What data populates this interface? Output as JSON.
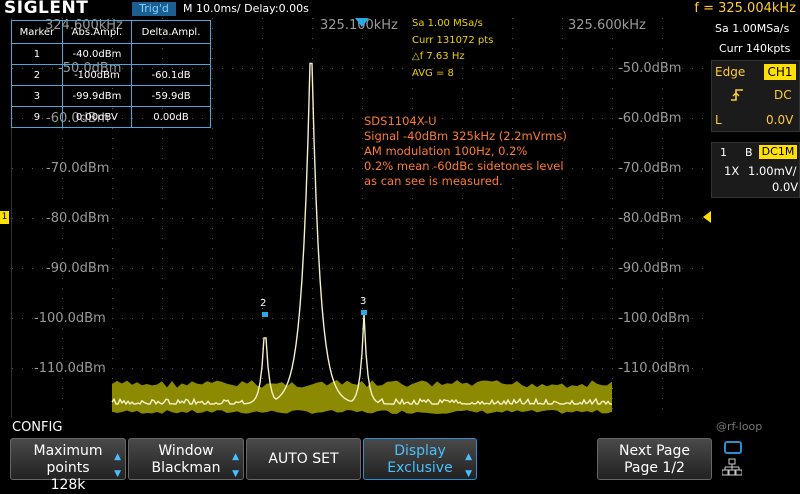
{
  "header": {
    "brand": "SIGLENT",
    "trigger_status": "Trig'd",
    "timebase": "M 10.0ms/ Delay:0.00s",
    "frequency": "f = 325.004kHz"
  },
  "fft": {
    "x_labels": [
      "324.600kHz",
      "325.100kHz",
      "325.600kHz"
    ],
    "y_labels": [
      "-50.0dBm",
      "-60.0dBm",
      "-70.0dBm",
      "-80.0dBm",
      "-90.0dBm",
      "-100.0dBm",
      "-110.0dBm"
    ],
    "stats": {
      "sample_rate": "Sa 1.00 MSa/s",
      "points": "Curr 131072 pts",
      "resolution": "△f 7.63 Hz",
      "average": "AVG = 8"
    },
    "markers": [
      "2",
      "3"
    ],
    "trace_color": "#f5f0c8",
    "noise_color": "#8c8a00"
  },
  "marker_table": {
    "headers": [
      "Marker",
      "Abs.Ampl.",
      "Delta.Ampl."
    ],
    "rows": [
      [
        "1",
        "-40.0dBm",
        ""
      ],
      [
        "2",
        "-100dBm",
        "-60.1dB"
      ],
      [
        "3",
        "-99.9dBm",
        "-59.9dB"
      ],
      [
        "9",
        "0.00dBV",
        "0.00dB"
      ]
    ]
  },
  "note": {
    "lines": [
      "SDS1104X-U",
      "Signal -40dBm 325kHz (2.2mVrms)",
      "AM modulation 100Hz, 0.2%",
      "0.2% mean -60dBc sidetones level",
      "as can see is measured."
    ]
  },
  "right_panel": {
    "sample_rate": "Sa 1.00MSa/s",
    "mem_depth": "Curr 140kpts",
    "trigger_label": "Edge",
    "trigger_channel": "CH1",
    "slope_icon": "rising-edge",
    "coupling": "DC",
    "level_label": "L",
    "level_value": "0.0V",
    "ch_number": "1",
    "bw_flag": "B",
    "ch_coupling": "DC1M",
    "probe": "1X",
    "vdiv": "1.00mV/",
    "offset": "0.0V",
    "ch_color": "#ffe000"
  },
  "menu": {
    "title": "CONFIG",
    "max_points_label": "Maximum points",
    "max_points_value": "128k",
    "window_label": "Window",
    "window_value": "Blackman",
    "autoset_label": "AUTO SET",
    "display_label": "Display",
    "display_value": "Exclusive",
    "next_page_label": "Next Page",
    "next_page_value": "Page 1/2"
  },
  "watermark": "@rf-loop"
}
